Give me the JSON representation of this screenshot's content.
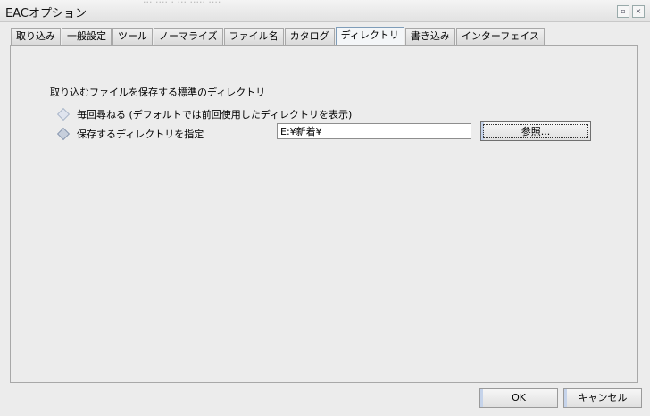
{
  "window": {
    "title": "EACオプション",
    "ghost_text": "... .... . ...  ..... ....",
    "buttons": {
      "restore": "▫",
      "close": "×"
    }
  },
  "tabs": [
    {
      "label": "取り込み"
    },
    {
      "label": "一般設定"
    },
    {
      "label": "ツール"
    },
    {
      "label": "ノーマライズ"
    },
    {
      "label": "ファイル名"
    },
    {
      "label": "カタログ"
    },
    {
      "label": "ディレクトリ",
      "active": true
    },
    {
      "label": "書き込み"
    },
    {
      "label": "インターフェイス"
    }
  ],
  "directory": {
    "section_label": "取り込むファイルを保存する標準のディレクトリ",
    "option_ask": "毎回尋ねる (デフォルトでは前回使用したディレクトリを表示)",
    "option_specify": "保存するディレクトリを指定",
    "path_value": "E:¥新着¥",
    "browse_label": "参照..."
  },
  "footer": {
    "ok_label": "OK",
    "cancel_label": "キャンセル"
  }
}
